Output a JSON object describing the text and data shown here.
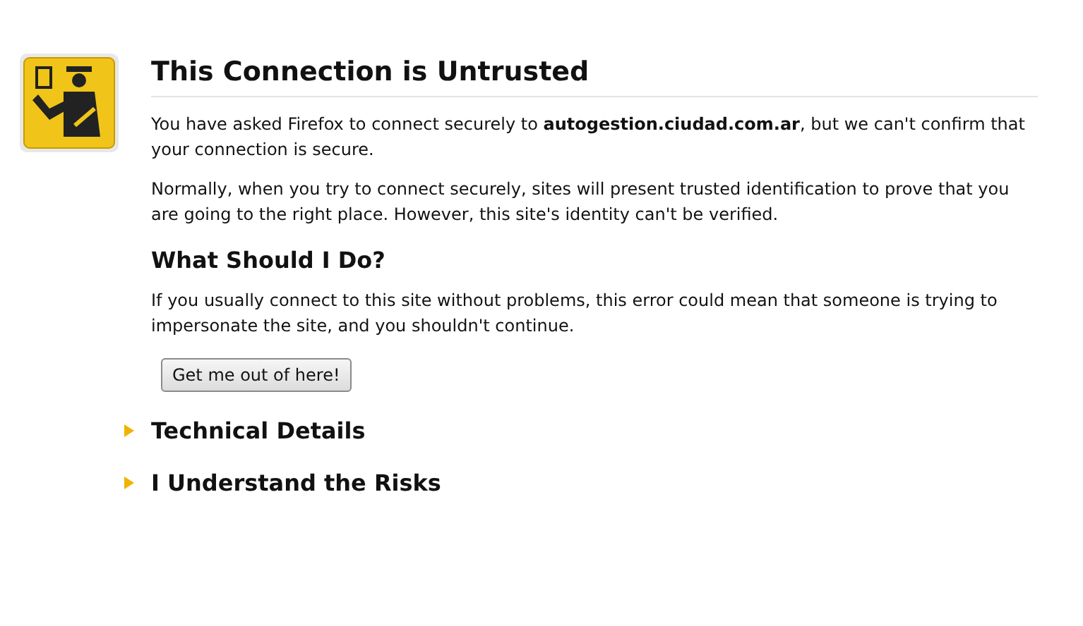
{
  "title": "This Connection is Untrusted",
  "intro": "You have asked Firefox to connect securely to **autogestion.ciudad.com.ar**, but we can't confirm that your connection is secure.",
  "explanation": "Normally, when you try to connect securely, sites will present trusted identification to prove that you are going to the right place. However, this site's identity can't be verified.",
  "advice_heading": "What Should I Do?",
  "advice": "If you usually connect to this site without problems, this error could mean that someone is trying to impersonate the site, and you shouldn't continue.",
  "button": "Get me out of here!",
  "sections": [
    {
      "label": "Technical Details",
      "expanded": false
    },
    {
      "label": "I Understand the Risks",
      "expanded": false
    }
  ]
}
